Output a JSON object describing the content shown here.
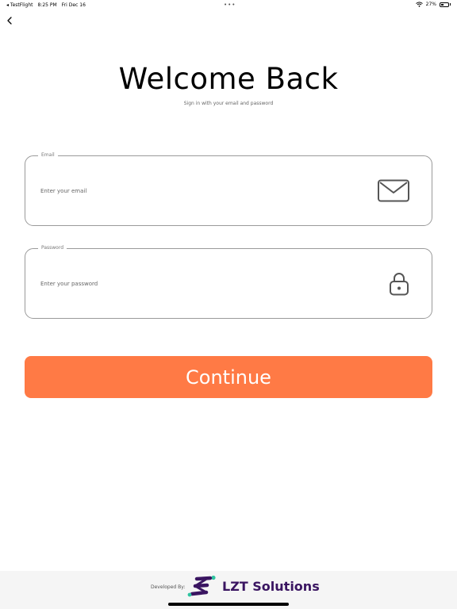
{
  "status_bar": {
    "app": "◂ TestFlight",
    "time": "8:25 PM",
    "date": "Fri Dec 16",
    "dots": "•••",
    "battery": "27%",
    "battery_level": 0.27
  },
  "header": {
    "back_icon": "chevron-left-icon",
    "title": "Welcome Back",
    "subtitle": "Sign in with your email and password"
  },
  "form": {
    "email": {
      "label": "Email",
      "placeholder": "Enter your email",
      "value": "",
      "icon": "envelope-icon"
    },
    "password": {
      "label": "Password",
      "placeholder": "Enter your password",
      "value": "",
      "icon": "lock-icon"
    },
    "continue_label": "Continue"
  },
  "footer": {
    "developed_by": "Developed By:",
    "brand": "LZT Solutions"
  },
  "colors": {
    "accent": "#ff7a45",
    "brand": "#3a1561",
    "brand_secondary": "#2ec4a0",
    "field_border": "#9a9a9a"
  }
}
